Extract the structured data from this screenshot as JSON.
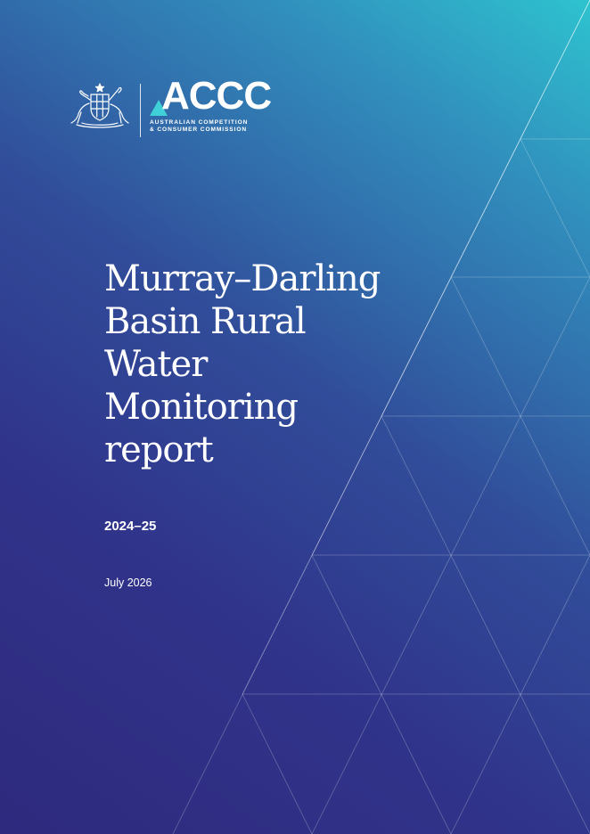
{
  "cover": {
    "title_lines": [
      "Murray–Darling",
      "Basin Rural",
      "Water",
      "Monitoring",
      "report"
    ],
    "period": "2024–25",
    "date": "July 2026"
  },
  "logo": {
    "wordmark": "ACCC",
    "subtitle_lines": [
      "AUSTRALIAN COMPETITION",
      "& CONSUMER COMMISSION"
    ],
    "crest_icon": "commonwealth-coat-of-arms-icon",
    "mark_icon": "triangle-mark-icon"
  },
  "colors": {
    "gradient_top_right": "#2ec3cf",
    "gradient_mid": "#314d9a",
    "gradient_bottom_left": "#2e2a7e",
    "logo_accent": "#3fd0d8",
    "text": "#ffffff"
  }
}
